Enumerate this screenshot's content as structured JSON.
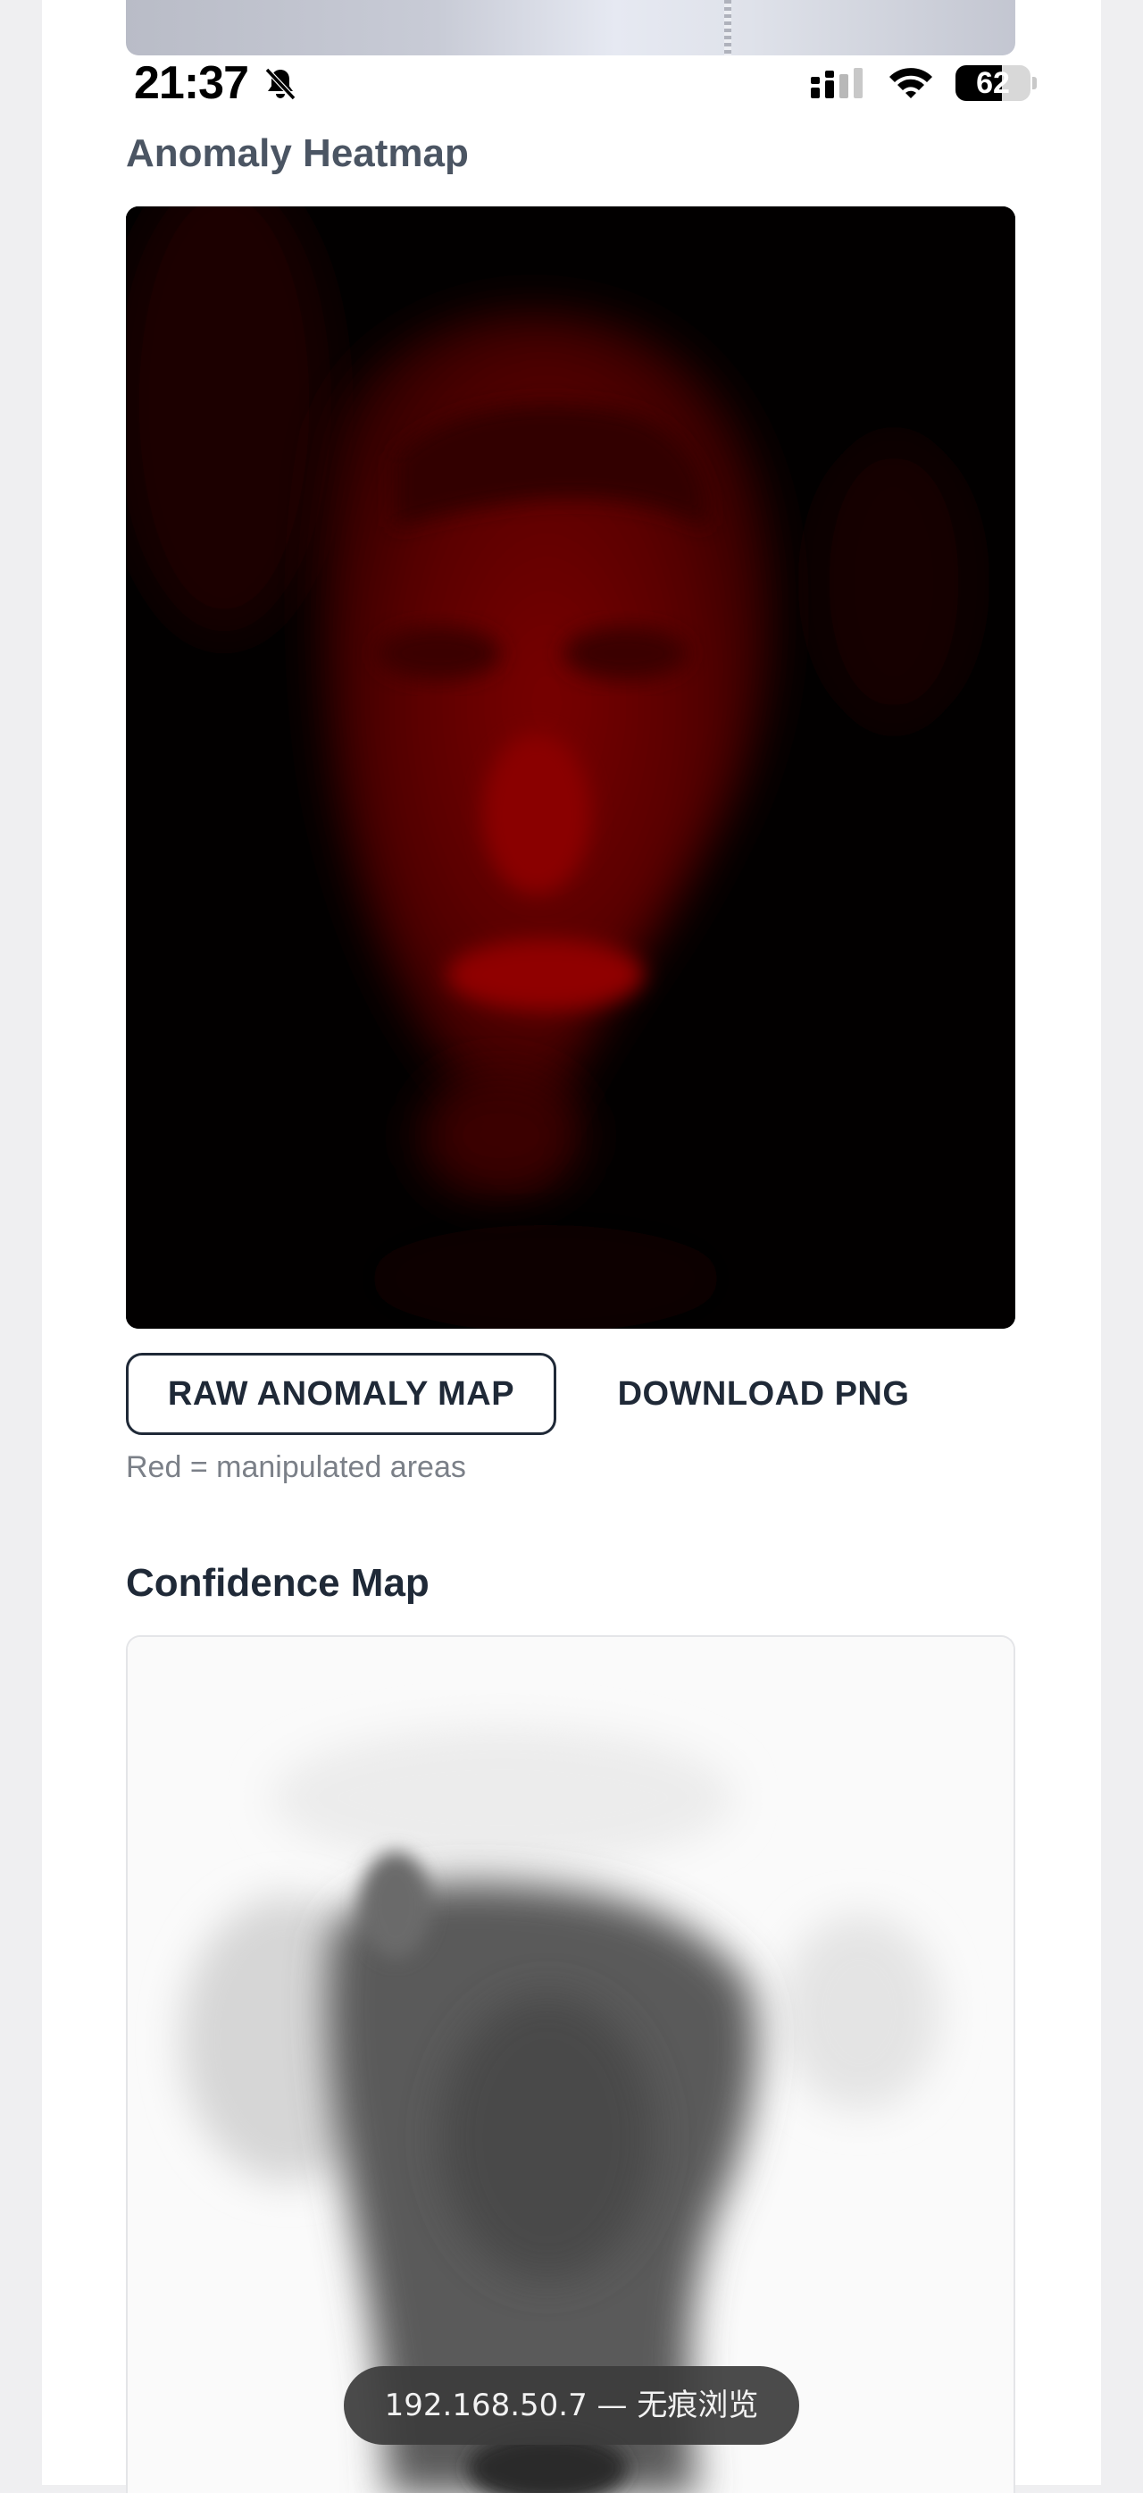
{
  "status_bar": {
    "time": "21:37",
    "battery_level": "62",
    "battery_fraction": 0.62
  },
  "icons": {
    "silent": "bell-slash-icon",
    "signal": "cellular-signal-icon",
    "wifi": "wifi-icon",
    "battery": "battery-icon"
  },
  "anomaly_section": {
    "title": "Anomaly Heatmap",
    "image_alt": "anomaly heatmap image",
    "raw_button_label": "RAW ANOMALY MAP",
    "download_button_label": "DOWNLOAD PNG",
    "caption": "Red = manipulated areas"
  },
  "confidence_section": {
    "title": "Confidence Map",
    "image_alt": "confidence map image"
  },
  "toast": {
    "text": "192.168.50.7 — 无痕浏览"
  },
  "colors": {
    "heat_red": "#b00000",
    "heat_bg": "#020000",
    "text_dark": "#1f2937",
    "caption_gray": "#7b8088"
  }
}
